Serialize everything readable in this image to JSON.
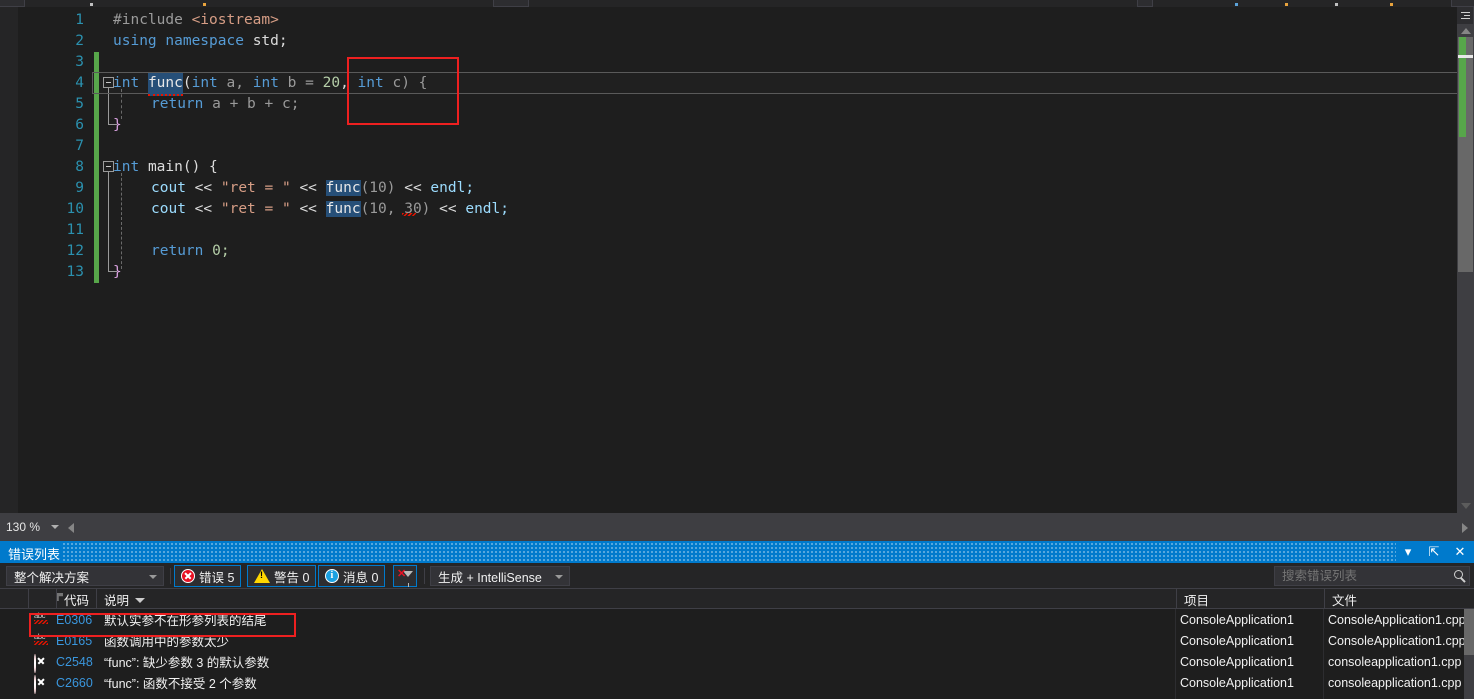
{
  "editor": {
    "zoom_level": "130 %",
    "lines": [
      {
        "n": "1",
        "text": "#include <iostream>"
      },
      {
        "n": "2",
        "text": "using namespace std;"
      },
      {
        "n": "3",
        "text": ""
      },
      {
        "n": "4",
        "text": "int func(int a, int b = 20, int c) {"
      },
      {
        "n": "5",
        "text": "    return a + b + c;"
      },
      {
        "n": "6",
        "text": "}"
      },
      {
        "n": "7",
        "text": ""
      },
      {
        "n": "8",
        "text": "int main() {"
      },
      {
        "n": "9",
        "text": "    cout << \"ret = \" << func(10) << endl;"
      },
      {
        "n": "10",
        "text": "    cout << \"ret = \" << func(10, 30) << endl;"
      },
      {
        "n": "11",
        "text": ""
      },
      {
        "n": "12",
        "text": "    return 0;"
      },
      {
        "n": "13",
        "text": "}"
      }
    ],
    "tokens": {
      "t_include": "#include",
      "t_iostream": "<iostream>",
      "t_using": "using",
      "t_namespace": "namespace",
      "t_std": "std;",
      "t_int": "int",
      "t_func": "func",
      "t_paren_open": "(",
      "t_int_a": "int",
      "t_a": "a,",
      "t_int_b": "int",
      "t_b_eq": "b = ",
      "t_20": "20",
      "t_comma": ",",
      "t_int_c": "int",
      "t_c_close": "c) {",
      "t_return": "return",
      "t_abc": "a + b + c;",
      "t_brace_close": "}",
      "t_main": "main() {",
      "t_cout": "cout",
      "t_shift": "<<",
      "t_str_ret": "\"ret = \"",
      "t_call1": "(10)",
      "t_call2": "(10, 30)",
      "t_endl": "endl;",
      "t_return0": "return",
      "t_zero": "0;"
    }
  },
  "error_list": {
    "title": "错误列表",
    "titlebar_buttons": {
      "dropdown": "▾",
      "pin": "⇱",
      "close": "✕"
    },
    "toolbar": {
      "scope_combo": "整个解决方案",
      "errors_label": "错误 5",
      "warnings_label": "警告 0",
      "messages_label": "消息 0",
      "clear_filter": "clear-filter-icon",
      "build_combo": "生成 + IntelliSense",
      "search_placeholder": "搜索错误列表"
    },
    "columns": [
      {
        "key": "icon",
        "label": ""
      },
      {
        "key": "code",
        "label": "代码"
      },
      {
        "key": "description",
        "label": "说明"
      },
      {
        "key": "project",
        "label": "项目"
      },
      {
        "key": "file",
        "label": "文件"
      }
    ],
    "sort_indicator": "▽",
    "rows": [
      {
        "severity": "intellisense",
        "code": "E0306",
        "description": "默认实参不在形参列表的结尾",
        "project": "ConsoleApplication1",
        "file": "ConsoleApplication1.cpp"
      },
      {
        "severity": "intellisense",
        "code": "E0165",
        "description": "函数调用中的参数太少",
        "project": "ConsoleApplication1",
        "file": "ConsoleApplication1.cpp"
      },
      {
        "severity": "error",
        "code": "C2548",
        "description": "“func”: 缺少参数 3 的默认参数",
        "project": "ConsoleApplication1",
        "file": "consoleapplication1.cpp"
      },
      {
        "severity": "error",
        "code": "C2660",
        "description": "“func”: 函数不接受 2 个参数",
        "project": "ConsoleApplication1",
        "file": "consoleapplication1.cpp"
      }
    ]
  },
  "annotations": {
    "code_highlight_label": "red-rectangle-around-int-c",
    "row_highlight_label": "red-rectangle-around-E0306-row",
    "color": "#ee2020"
  }
}
